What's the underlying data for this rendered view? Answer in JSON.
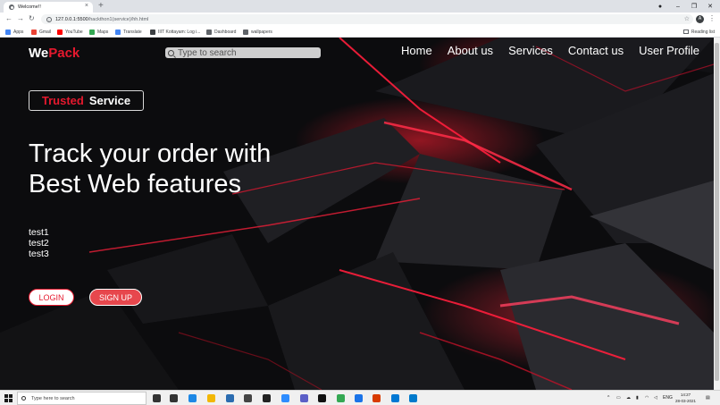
{
  "browser": {
    "tab_title": "Welcome!!",
    "tab_close": "×",
    "new_tab": "+",
    "url_host": "127.0.0.1:5500",
    "url_path": "/hackthon1(service)/hh.html",
    "window_controls": {
      "minimize": "–",
      "restore": "❐",
      "close": "✕"
    },
    "nav": {
      "back": "←",
      "forward": "→",
      "reload": "↻"
    },
    "profile_initial": "A",
    "bookmarks": [
      {
        "label": "Apps",
        "icon": "apps-icon",
        "color": "#4285f4"
      },
      {
        "label": "Gmail",
        "icon": "gmail-icon",
        "color": "#ea4335"
      },
      {
        "label": "YouTube",
        "icon": "youtube-icon",
        "color": "#ff0000"
      },
      {
        "label": "Maps",
        "icon": "maps-icon",
        "color": "#34a853"
      },
      {
        "label": "Translate",
        "icon": "translate-icon",
        "color": "#4285f4"
      },
      {
        "label": "IIIT Kottayam: Log i...",
        "icon": "globe-icon",
        "color": "#3c4043"
      },
      {
        "label": "Dashboard",
        "icon": "dashboard-icon",
        "color": "#5f6368"
      },
      {
        "label": "wallpapers",
        "icon": "wallpapers-icon",
        "color": "#5f6368"
      }
    ],
    "reading_list": "Reading list"
  },
  "site": {
    "logo_we": "We",
    "logo_pack": "Pack",
    "search_placeholder": "Type to search",
    "nav": [
      "Home",
      "About us",
      "Services",
      "Contact us",
      "User Profile"
    ],
    "badge_trusted": "Trusted",
    "badge_service": "Service",
    "hero_line1": "Track your order with",
    "hero_line2": "Best Web features",
    "list": [
      "test1",
      "test2",
      "test3"
    ],
    "login_label": "LOGIN",
    "signup_label": "SIGN UP",
    "accent_color": "#e6192e"
  },
  "taskbar": {
    "search_placeholder": "Type here to search",
    "language": "ENG",
    "time": "14:27",
    "date": "28-03-2021",
    "apps": [
      {
        "icon": "task-view-icon",
        "color": "#333333"
      },
      {
        "icon": "widgets-icon",
        "color": "#333333"
      },
      {
        "icon": "edge-icon",
        "color": "#1e88e5"
      },
      {
        "icon": "file-explorer-icon",
        "color": "#f2b705"
      },
      {
        "icon": "calendar-app-icon",
        "color": "#2b6cb0"
      },
      {
        "icon": "store-icon",
        "color": "#444444"
      },
      {
        "icon": "xbox-icon",
        "color": "#222222"
      },
      {
        "icon": "zoom-icon",
        "color": "#2d8cff"
      },
      {
        "icon": "teams-icon",
        "color": "#5b5fc7"
      },
      {
        "icon": "photo-app-icon",
        "color": "#111111"
      },
      {
        "icon": "chrome-icon",
        "color": "#34a853"
      },
      {
        "icon": "notepad-icon",
        "color": "#1a73e8"
      },
      {
        "icon": "office-icon",
        "color": "#d83b01"
      },
      {
        "icon": "mail-app-icon",
        "color": "#0078d4"
      },
      {
        "icon": "vscode-icon",
        "color": "#007acc"
      }
    ]
  }
}
